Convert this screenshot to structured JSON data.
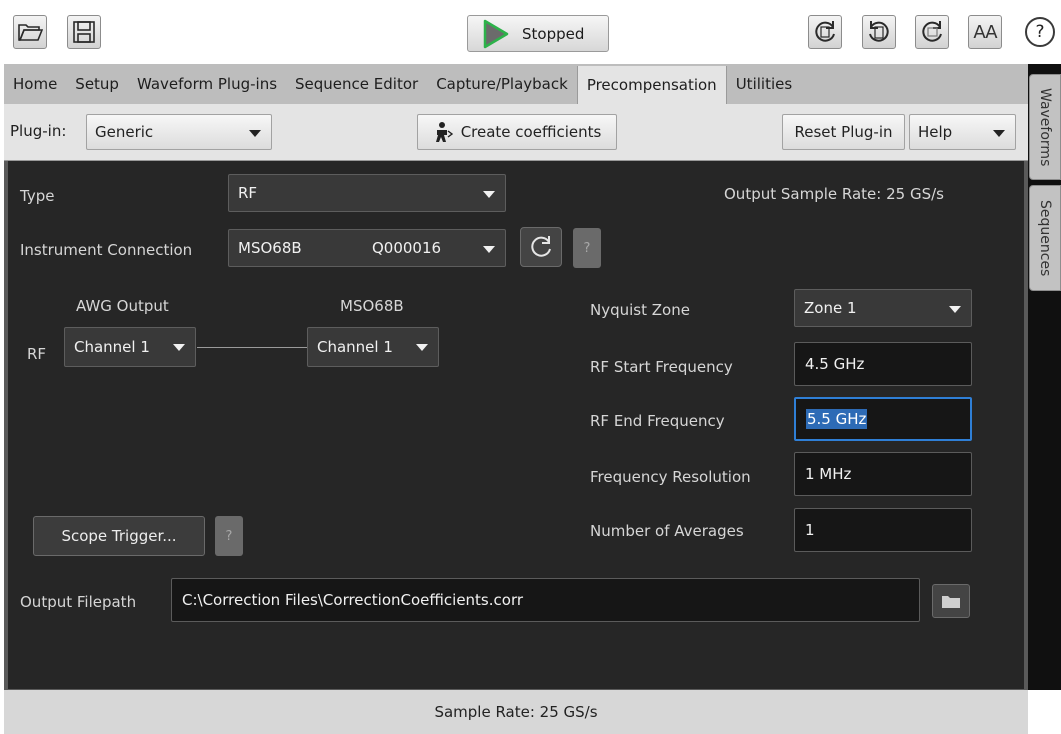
{
  "toolbar": {
    "open_icon": "folder-open-icon",
    "save_icon": "floppy-save-icon",
    "run_state": "Stopped",
    "font_size_label": "AA",
    "help_label": "?"
  },
  "tabs": [
    {
      "label": "Home"
    },
    {
      "label": "Setup"
    },
    {
      "label": "Waveform Plug-ins"
    },
    {
      "label": "Sequence Editor"
    },
    {
      "label": "Capture/Playback"
    },
    {
      "label": "Precompensation",
      "active": true
    },
    {
      "label": "Utilities"
    }
  ],
  "subbar": {
    "plugin_label": "Plug-in:",
    "plugin_value": "Generic",
    "create_label": "Create coefficients",
    "reset_label": "Reset Plug-in",
    "help_value": "Help"
  },
  "form": {
    "type_label": "Type",
    "type_value": "RF",
    "output_sample_rate": "Output Sample Rate:  25 GS/s",
    "conn_label": "Instrument Connection",
    "conn_model": "MSO68B",
    "conn_serial": "Q000016",
    "help_q": "?",
    "awg_output_label": "AWG Output",
    "scope_label": "MSO68B",
    "rf_label": "RF",
    "awg_channel": "Channel 1",
    "scope_channel": "Channel 1",
    "nyquist_label": "Nyquist Zone",
    "nyquist_value": "Zone 1",
    "rf_start_label": "RF Start Frequency",
    "rf_start_value": "4.5 GHz",
    "rf_end_label": "RF End Frequency",
    "rf_end_value": "5.5 GHz",
    "freq_res_label": "Frequency Resolution",
    "freq_res_value": "1 MHz",
    "averages_label": "Number of Averages",
    "averages_value": "1",
    "scope_trigger_label": "Scope Trigger...",
    "filepath_label": "Output Filepath",
    "filepath_value": "C:\\Correction Files\\CorrectionCoefficients.corr"
  },
  "side_tabs": {
    "waveforms": "Waveforms",
    "sequences": "Sequences"
  },
  "status": {
    "sample_rate": "Sample Rate: 25 GS/s"
  },
  "colors": {
    "accent_focus": "#2f7fd6",
    "play_green": "#2db24a",
    "panel_bg": "#262626"
  }
}
